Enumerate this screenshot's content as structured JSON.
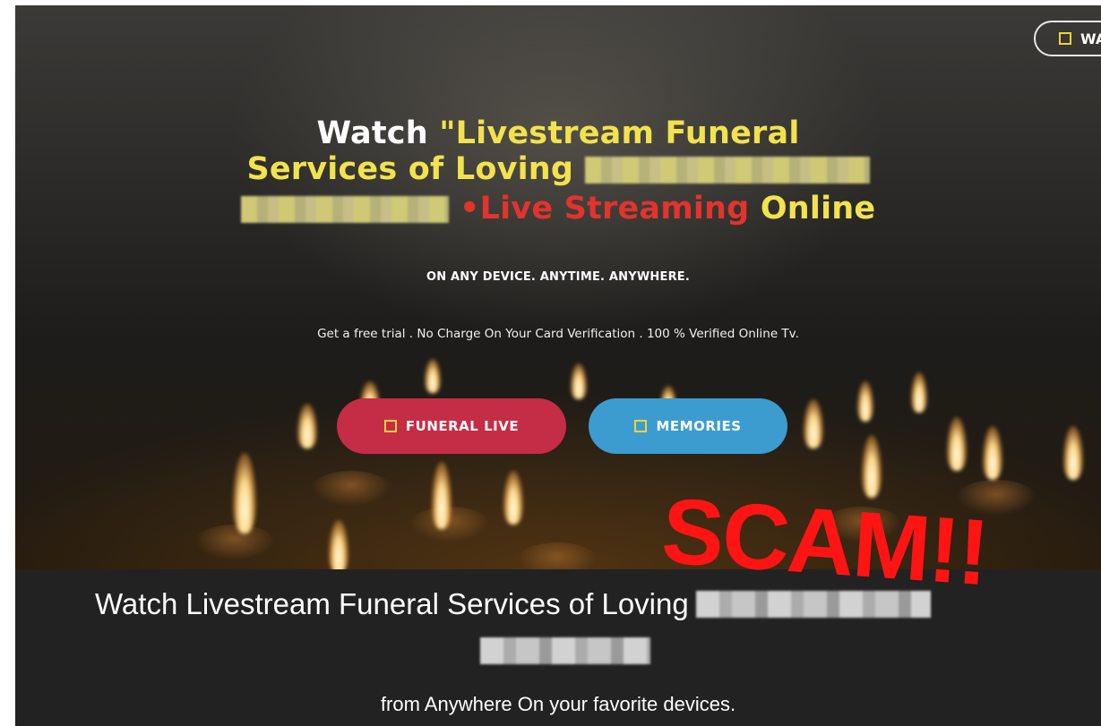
{
  "header": {
    "wa_button_label": "WA"
  },
  "hero": {
    "headline_watch": "Watch ",
    "headline_quote": "\"Livestream Funeral",
    "headline_line2": "Services of Loving ",
    "headline_live_streaming": "•Live Streaming ",
    "headline_online": "Online",
    "tagline": "ON ANY DEVICE. ANYTIME. ANYWHERE.",
    "subline": "Get a free trial . No Charge On Your Card Verification . 100 % Verified Online Tv.",
    "buttons": [
      {
        "label": "FUNERAL LIVE",
        "color": "#c42d45",
        "icon": "square-icon"
      },
      {
        "label": "MEMORIES",
        "color": "#3d9ccf",
        "icon": "square-icon"
      }
    ]
  },
  "overlay": {
    "scam_text": "SCAM!!",
    "color": "#ff1414"
  },
  "bottom": {
    "title": "Watch Livestream Funeral Services of Loving",
    "from_text": "from Anywhere On your favorite devices."
  },
  "colors": {
    "headline_yellow": "#f2e24e",
    "headline_red": "#e2332d",
    "icon_yellow": "#f0d23c"
  }
}
